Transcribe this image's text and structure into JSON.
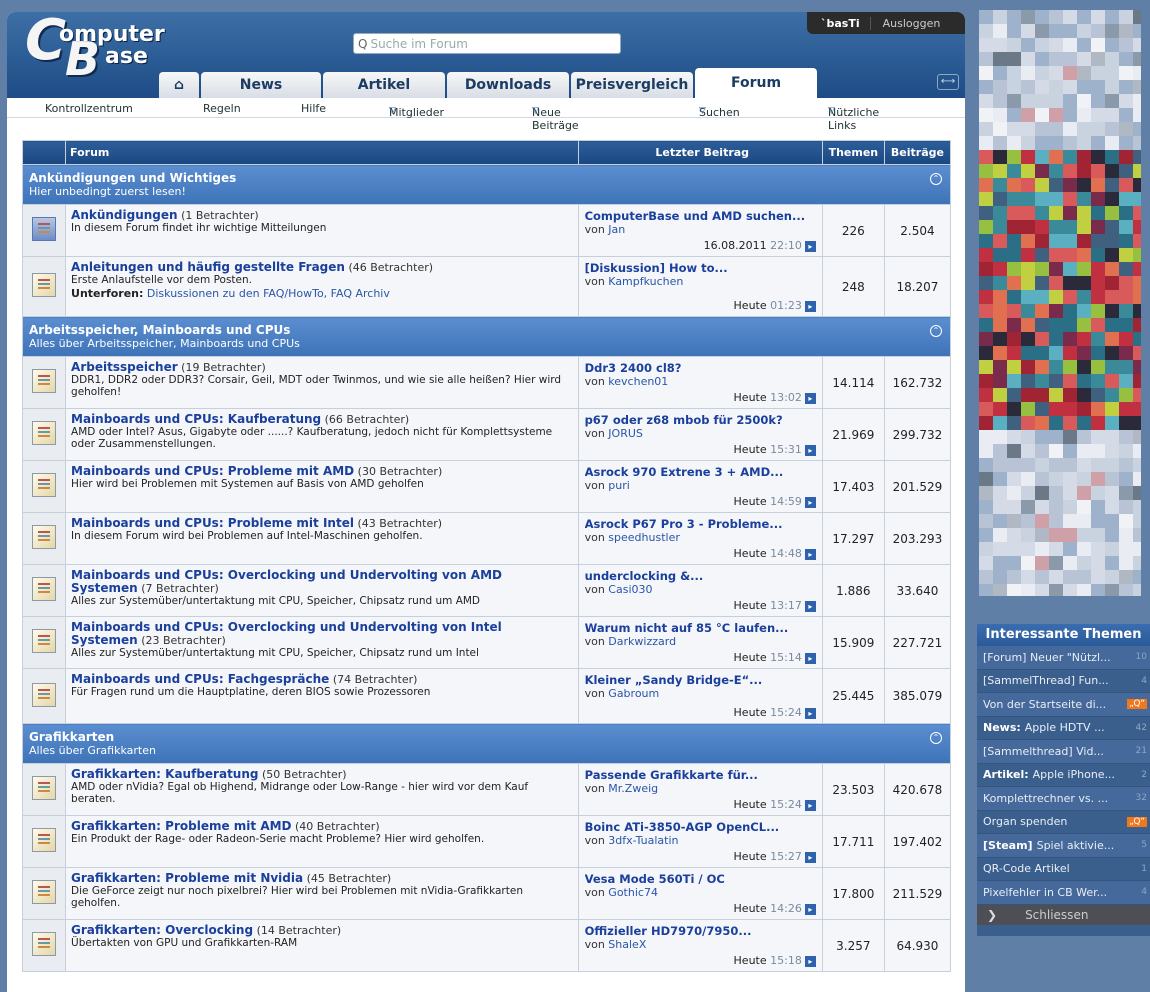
{
  "logo": {
    "line1": "omputer",
    "line2": "ase",
    "c": "C",
    "b": "B"
  },
  "search": {
    "placeholder": "Suche im Forum",
    "icon": "search-icon"
  },
  "user": {
    "name": "`basTi",
    "logout": "Ausloggen"
  },
  "tabs": [
    {
      "label": "⌂",
      "icon": "home-icon"
    },
    {
      "label": "News"
    },
    {
      "label": "Artikel"
    },
    {
      "label": "Downloads"
    },
    {
      "label": "Preisvergleich"
    },
    {
      "label": "Forum",
      "active": true
    }
  ],
  "subnav": [
    "Kontrollzentrum",
    "Regeln",
    "Hilfe",
    "Mitglieder",
    "Neue Beiträge",
    "Suchen",
    "Nützliche Links"
  ],
  "table_headers": {
    "forum": "Forum",
    "last": "Letzter Beitrag",
    "themen": "Themen",
    "beitraege": "Beiträge"
  },
  "categories": [
    {
      "title": "Ankündigungen und Wichtiges",
      "desc": "Hier unbedingt zuerst lesen!",
      "forums": [
        {
          "name": "Ankündigungen",
          "viewers": "(1 Betrachter)",
          "desc": "In diesem Forum findet ihr wichtige Mitteilungen",
          "icon": "cb",
          "last_title": "ComputerBase und AMD suchen...",
          "by": "von",
          "author": "Jan",
          "date": "16.08.2011",
          "time": "22:10",
          "themen": "226",
          "beitraege": "2.504"
        },
        {
          "name": "Anleitungen und häufig gestellte Fragen",
          "viewers": "(46 Betrachter)",
          "desc": "Erste Anlaufstelle vor dem Posten.",
          "sub_label": "Unterforen:",
          "sub1": "Diskussionen zu den FAQ/HowTo,",
          "sub2": "FAQ Archiv",
          "last_title": "[Diskussion] How to...",
          "by": "von",
          "author": "Kampfkuchen",
          "date": "Heute",
          "time": "01:23",
          "themen": "248",
          "beitraege": "18.207"
        }
      ]
    },
    {
      "title": "Arbeitsspeicher, Mainboards und CPUs",
      "desc": "Alles über Arbeitsspeicher, Mainboards und CPUs",
      "forums": [
        {
          "name": "Arbeitsspeicher",
          "viewers": "(19 Betrachter)",
          "desc": "DDR1, DDR2 oder DDR3? Corsair, Geil, MDT oder Twinmos, und wie sie alle heißen? Hier wird geholfen!",
          "last_title": "Ddr3 2400 cl8?",
          "by": "von",
          "author": "kevchen01",
          "date": "Heute",
          "time": "13:02",
          "themen": "14.114",
          "beitraege": "162.732"
        },
        {
          "name": "Mainboards und CPUs: Kaufberatung",
          "viewers": "(66 Betrachter)",
          "desc": "AMD oder Intel? Asus, Gigabyte oder ......? Kaufberatung, jedoch nicht für Komplettsysteme oder Zusammenstellungen.",
          "last_title": "p67 oder z68 mbob für 2500k?",
          "by": "von",
          "author": "JORUS",
          "date": "Heute",
          "time": "15:31",
          "themen": "21.969",
          "beitraege": "299.732"
        },
        {
          "name": "Mainboards und CPUs: Probleme mit AMD",
          "viewers": "(30 Betrachter)",
          "desc": "Hier wird bei Problemen mit Systemen auf Basis von AMD geholfen",
          "last_title": "Asrock 970 Extrene 3 + AMD...",
          "by": "von",
          "author": "puri",
          "date": "Heute",
          "time": "14:59",
          "themen": "17.403",
          "beitraege": "201.529"
        },
        {
          "name": "Mainboards und CPUs: Probleme mit Intel",
          "viewers": "(43 Betrachter)",
          "desc": "In diesem Forum wird bei Problemen auf Intel-Maschinen geholfen.",
          "last_title": "Asrock P67 Pro 3 - Probleme...",
          "by": "von",
          "author": "speedhustler",
          "date": "Heute",
          "time": "14:48",
          "themen": "17.297",
          "beitraege": "203.293"
        },
        {
          "name": "Mainboards und CPUs: Overclocking und Undervolting von AMD Systemen",
          "viewers": "(7 Betrachter)",
          "desc": "Alles zur Systemüber/untertaktung mit CPU, Speicher, Chipsatz rund um AMD",
          "last_title": "underclocking &...",
          "by": "von",
          "author": "Casi030",
          "date": "Heute",
          "time": "13:17",
          "themen": "1.886",
          "beitraege": "33.640"
        },
        {
          "name": "Mainboards und CPUs: Overclocking und Undervolting von Intel Systemen",
          "viewers": "(23 Betrachter)",
          "desc": "Alles zur Systemüber/untertaktung mit CPU, Speicher, Chipsatz rund um Intel",
          "last_title": "Warum nicht auf 85 °C laufen...",
          "by": "von",
          "author": "Darkwizzard",
          "date": "Heute",
          "time": "15:14",
          "themen": "15.909",
          "beitraege": "227.721"
        },
        {
          "name": "Mainboards und CPUs: Fachgespräche",
          "viewers": "(74 Betrachter)",
          "desc": "Für Fragen rund um die Hauptplatine, deren BIOS sowie Prozessoren",
          "last_title": "Kleiner „Sandy Bridge-E“...",
          "by": "von",
          "author": "Gabroum",
          "date": "Heute",
          "time": "15:24",
          "themen": "25.445",
          "beitraege": "385.079"
        }
      ]
    },
    {
      "title": "Grafikkarten",
      "desc": "Alles über Grafikkarten",
      "forums": [
        {
          "name": "Grafikkarten: Kaufberatung",
          "viewers": "(50 Betrachter)",
          "desc": "AMD oder nVidia? Egal ob Highend, Midrange oder Low-Range - hier wird vor dem Kauf beraten.",
          "last_title": "Passende Grafikkarte für...",
          "by": "von",
          "author": "Mr.Zweig",
          "date": "Heute",
          "time": "15:24",
          "themen": "23.503",
          "beitraege": "420.678"
        },
        {
          "name": "Grafikkarten: Probleme mit AMD",
          "viewers": "(40 Betrachter)",
          "desc": "Ein Produkt der Rage- oder Radeon-Serie macht Probleme? Hier wird geholfen.",
          "last_title": "Boinc ATi-3850-AGP OpenCL...",
          "by": "von",
          "author": "3dfx-Tualatin",
          "date": "Heute",
          "time": "15:27",
          "themen": "17.711",
          "beitraege": "197.402"
        },
        {
          "name": "Grafikkarten: Probleme mit Nvidia",
          "viewers": "(45 Betrachter)",
          "desc": "Die GeForce zeigt nur noch pixelbrei? Hier wird bei Problemen mit nVidia-Grafikkarten geholfen.",
          "last_title": "Vesa Mode 560Ti / OC",
          "by": "von",
          "author": "Gothic74",
          "date": "Heute",
          "time": "14:26",
          "themen": "17.800",
          "beitraege": "211.529"
        },
        {
          "name": "Grafikkarten: Overclocking",
          "viewers": "(14 Betrachter)",
          "desc": "Übertakten von GPU und Grafikkarten-RAM",
          "last_title": "Offizieller HD7970/7950...",
          "by": "von",
          "author": "ShaleX",
          "date": "Heute",
          "time": "15:18",
          "themen": "3.257",
          "beitraege": "64.930"
        }
      ]
    }
  ],
  "interessante": {
    "title": "Interessante Themen",
    "close": "Schliessen",
    "items": [
      {
        "prefix": "",
        "text": "[Forum] Neuer \"Nützl...",
        "count": "10"
      },
      {
        "prefix": "",
        "text": "[SammelThread] Fun...",
        "count": "4"
      },
      {
        "prefix": "",
        "text": "Von der Startseite di...",
        "badge": "„Q“"
      },
      {
        "prefix": "News:",
        "text": "Apple HDTV ...",
        "count": "42"
      },
      {
        "prefix": "",
        "text": "[Sammelthread] Vid...",
        "count": "21"
      },
      {
        "prefix": "Artikel:",
        "text": "Apple iPhone...",
        "count": "2"
      },
      {
        "prefix": "",
        "text": "Komplettrechner vs. ...",
        "count": "32"
      },
      {
        "prefix": "",
        "text": "Organ spenden",
        "badge": "„Q“"
      },
      {
        "prefix": "[Steam]",
        "text": "Spiel aktivie...",
        "count": "5"
      },
      {
        "prefix": "",
        "text": "QR-Code Artikel",
        "count": "1"
      },
      {
        "prefix": "",
        "text": "Pixelfehler in CB Wer...",
        "count": "4"
      }
    ]
  },
  "colors": {
    "header": "#1e4c86",
    "category": "#4a80c4",
    "accent_orange": "#f0771c",
    "link": "#1a3f9c"
  }
}
